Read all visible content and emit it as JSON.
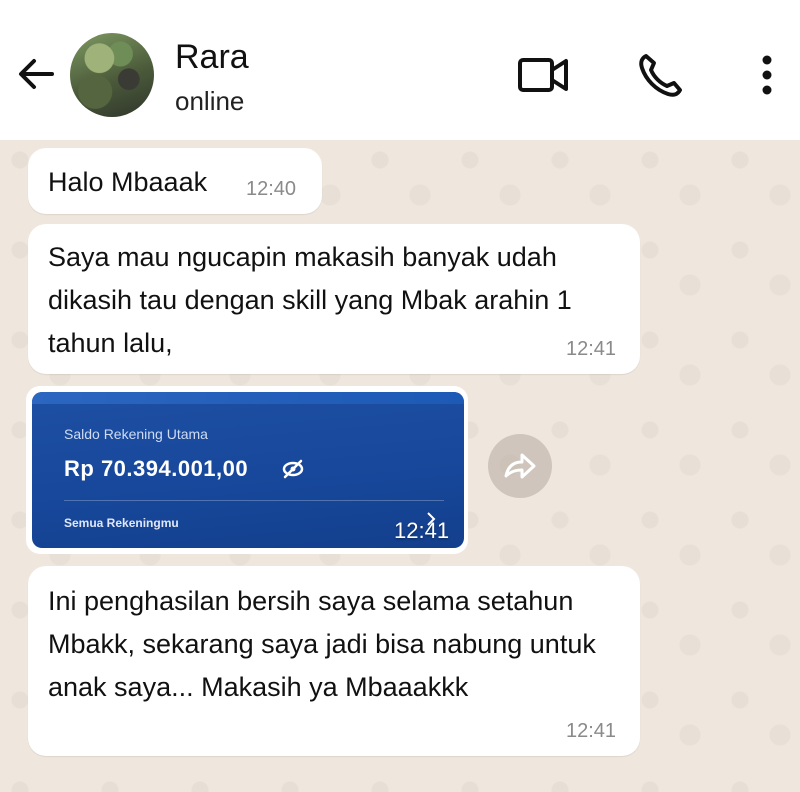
{
  "header": {
    "contact_name": "Rara",
    "status": "online",
    "icons": [
      "back-arrow-icon",
      "video-call-icon",
      "phone-call-icon",
      "more-vertical-icon"
    ]
  },
  "messages": [
    {
      "text": "Halo Mbaaak",
      "time": "12:40"
    },
    {
      "text": "Saya mau ngucapin makasih banyak udah dikasih tau dengan skill yang Mbak arahin 1 tahun lalu,",
      "time": "12:41"
    },
    {
      "image": {
        "card_title": "Saldo Rekening Utama",
        "balance": "Rp 70.394.001,00",
        "link_text": "Semua Rekeningmu"
      },
      "time": "12:41"
    },
    {
      "text": "Ini penghasilan bersih saya selama setahun Mbakk, sekarang saya jadi bisa nabung untuk anak saya... Makasih ya Mbaaakkk",
      "time": "12:41"
    }
  ],
  "colors": {
    "chat_background": "#efe7dd",
    "bubble": "#ffffff",
    "bank_card": "#1d4fa3"
  }
}
